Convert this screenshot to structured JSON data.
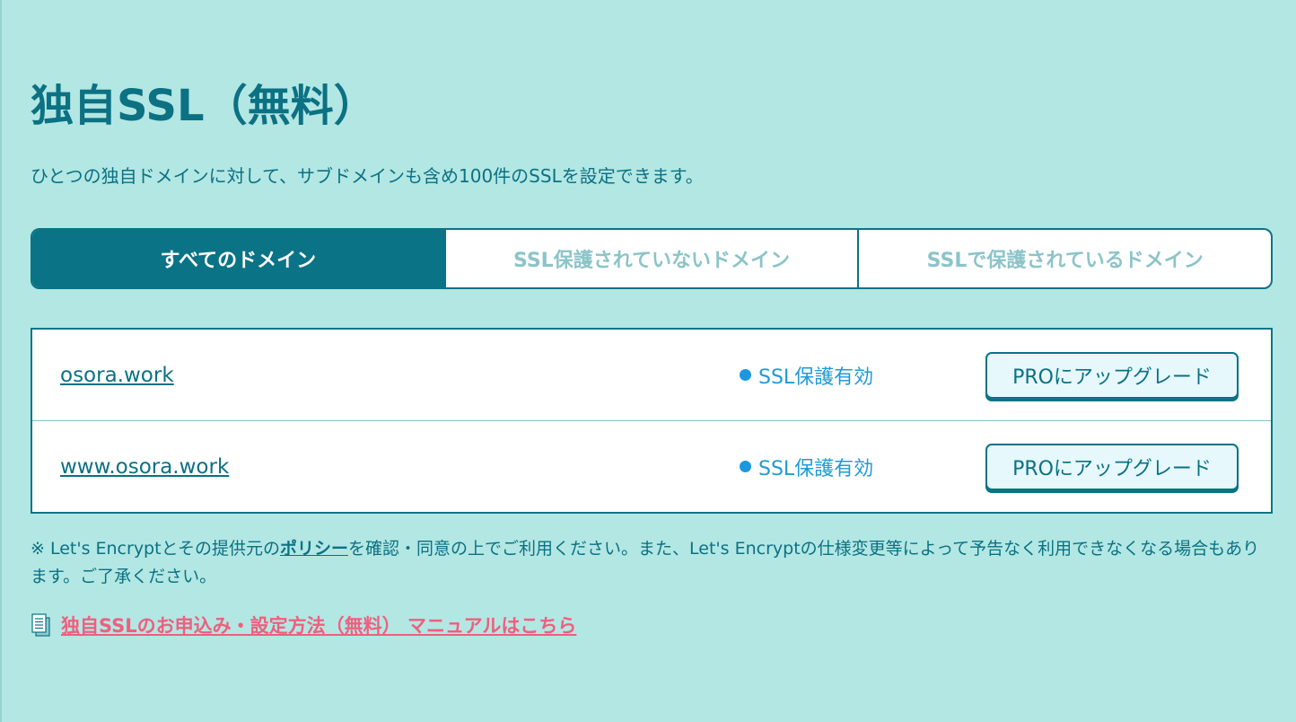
{
  "page": {
    "title": "独自SSL（無料）",
    "description": "ひとつの独自ドメインに対して、サブドメインも含め100件のSSLを設定できます。"
  },
  "tabs": [
    {
      "label": "すべてのドメイン",
      "active": true
    },
    {
      "label": "SSL保護されていないドメイン",
      "active": false
    },
    {
      "label": "SSLで保護されているドメイン",
      "active": false
    }
  ],
  "domains": [
    {
      "name": "osora.work",
      "status": "SSL保護有効",
      "action": "PROにアップグレード"
    },
    {
      "name": "www.osora.work",
      "status": "SSL保護有効",
      "action": "PROにアップグレード"
    }
  ],
  "note": {
    "prefix": "※ Let's Encryptとその提供元の",
    "policy_link": "ポリシー",
    "suffix": "を確認・同意の上でご利用ください。また、Let's Encryptの仕様変更等によって予告なく利用できなくなる場合もあります。ご了承ください。"
  },
  "manual": {
    "icon": "document-icon",
    "link": "独自SSLのお申込み・設定方法（無料） マニュアルはこちら"
  },
  "colors": {
    "background": "#b3e7e3",
    "primary": "#0a7386",
    "status_dot": "#1a98e0",
    "manual_link": "#ef5f7d"
  }
}
